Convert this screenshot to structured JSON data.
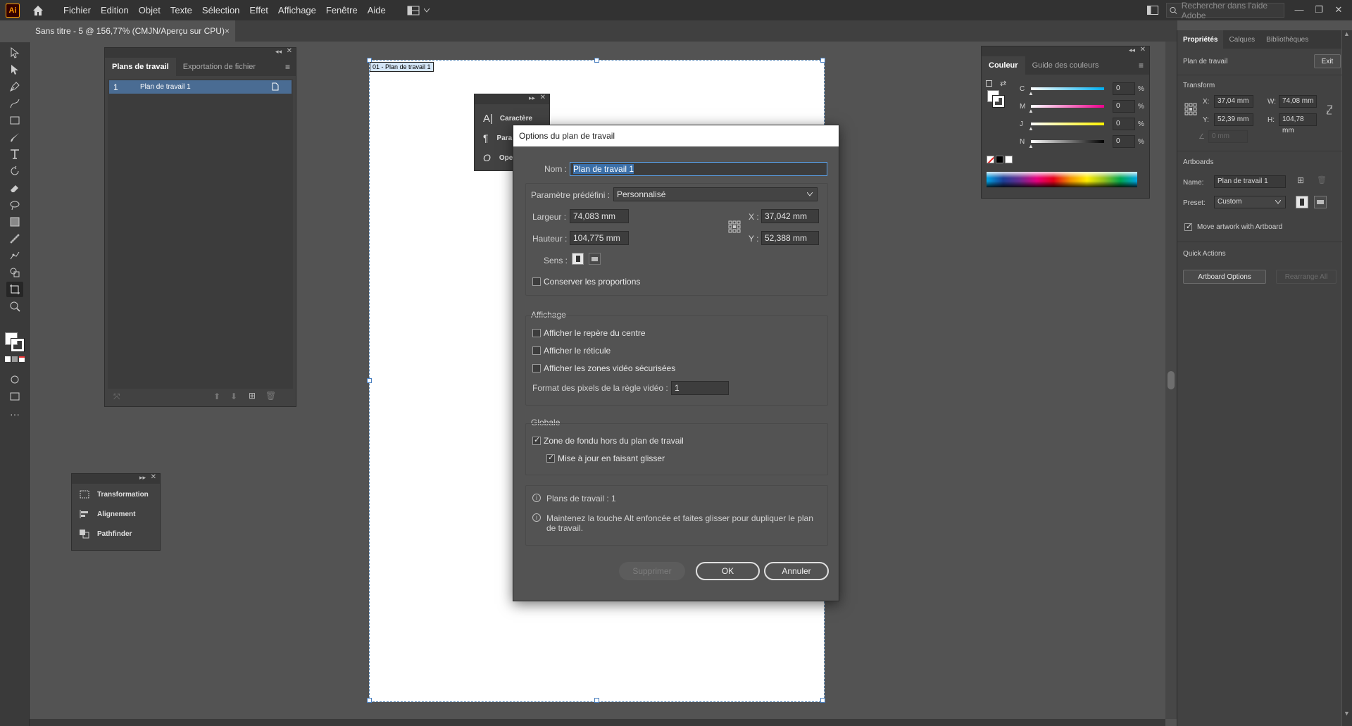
{
  "app": {
    "logo": "Ai"
  },
  "menu": {
    "items": [
      "Fichier",
      "Edition",
      "Objet",
      "Texte",
      "Sélection",
      "Effet",
      "Affichage",
      "Fenêtre",
      "Aide"
    ],
    "search_placeholder": "Rechercher dans l'aide Adobe"
  },
  "document_tab": {
    "title": "Sans titre - 5 @ 156,77% (CMJN/Aperçu sur CPU)",
    "close": "×"
  },
  "artboards_panel": {
    "tabs": [
      "Plans de travail",
      "Exportation de fichier"
    ],
    "rows": [
      {
        "index": "1",
        "name": "Plan de travail 1"
      }
    ]
  },
  "artboard_label": "01 - Plan de travail 1",
  "character_panel": {
    "items": [
      "Caractère",
      "Para",
      "Ope"
    ]
  },
  "mini_panel": {
    "items": [
      "Transformation",
      "Alignement",
      "Pathfinder"
    ]
  },
  "color_panel": {
    "tabs": [
      "Couleur",
      "Guide des couleurs"
    ],
    "channels": [
      {
        "label": "C",
        "value": "0"
      },
      {
        "label": "M",
        "value": "0"
      },
      {
        "label": "J",
        "value": "0"
      },
      {
        "label": "N",
        "value": "0"
      }
    ],
    "percent": "%"
  },
  "dialog": {
    "title": "Options du plan de travail",
    "name_label": "Nom :",
    "name_value": "Plan de travail 1",
    "preset_label": "Paramètre prédéfini :",
    "preset_value": "Personnalisé",
    "width_label": "Largeur :",
    "width_value": "74,083 mm",
    "height_label": "Hauteur :",
    "height_value": "104,775 mm",
    "x_label": "X :",
    "x_value": "37,042 mm",
    "y_label": "Y :",
    "y_value": "52,388 mm",
    "orientation_label": "Sens :",
    "keep_proportions": "Conserver les proportions",
    "display_title": "Affichage",
    "show_center": "Afficher le repère du centre",
    "show_crosshair": "Afficher le réticule",
    "show_video_safe": "Afficher les zones vidéo sécurisées",
    "pixel_ratio_label": "Format des pixels de la règle vidéo :",
    "pixel_ratio_value": "1",
    "global_title": "Globale",
    "fade_region": "Zone de fondu hors du plan de travail",
    "update_dragging": "Mise à jour en faisant glisser",
    "info_count": "Plans de travail : 1",
    "info_alt": "Maintenez la touche Alt enfoncée et faites glisser pour dupliquer le plan de travail.",
    "delete_label": "Supprimer",
    "ok_label": "OK",
    "cancel_label": "Annuler",
    "checks": {
      "keep_proportions": false,
      "show_center": false,
      "show_crosshair": false,
      "show_video_safe": false,
      "fade_region": true,
      "update_dragging": true
    }
  },
  "properties": {
    "tabs": [
      "Propriétés",
      "Calques",
      "Bibliothèques"
    ],
    "section_title": "Plan de travail",
    "exit_label": "Exit",
    "transform_title": "Transform",
    "x_label": "X:",
    "x_value": "37,04 mm",
    "y_label": "Y:",
    "y_value": "52,39 mm",
    "w_label": "W:",
    "w_value": "74,08 mm",
    "h_label": "H:",
    "h_value": "104,78 mm",
    "angle_value": "0 mm",
    "artboards_title": "Artboards",
    "name_label": "Name:",
    "name_value": "Plan de travail 1",
    "preset_label": "Preset:",
    "preset_value": "Custom",
    "move_artwork": "Move artwork with Artboard",
    "quick_actions": "Quick Actions",
    "artboard_options": "Artboard Options",
    "rearrange_all": "Rearrange All"
  },
  "colors": {
    "accent": "#3b6fa8",
    "bg": "#535353",
    "panel": "#424242",
    "dark": "#323232"
  }
}
